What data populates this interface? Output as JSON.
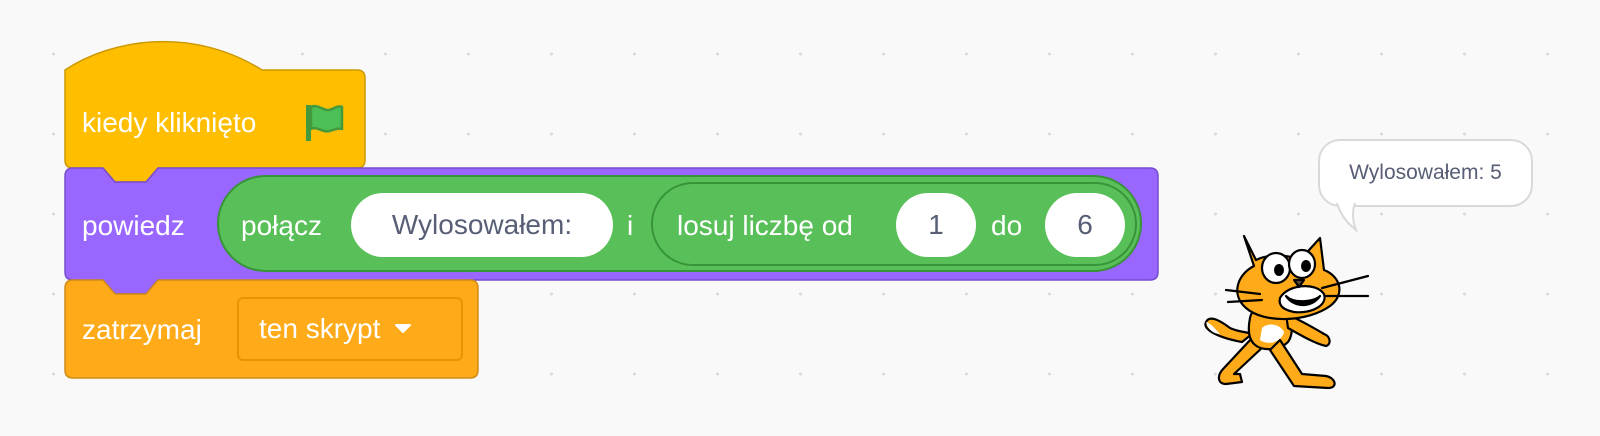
{
  "blocks": {
    "hat": {
      "label": "kiedy kliknięto",
      "icon": "green-flag-icon",
      "color": "#ffbf00"
    },
    "say": {
      "label": "powiedz",
      "color": "#9966ff",
      "join": {
        "label": "połącz",
        "input1": "Wylosowałem:",
        "connector": "i",
        "random": {
          "label": "losuj liczbę od",
          "from": "1",
          "to_label": "do",
          "to": "6"
        },
        "color": "#59c059"
      }
    },
    "stop": {
      "label": "zatrzymaj",
      "option": "ten skrypt",
      "color": "#ffab19"
    }
  },
  "sprite": {
    "name": "cat",
    "speech": "Wylosowałem: 5"
  }
}
